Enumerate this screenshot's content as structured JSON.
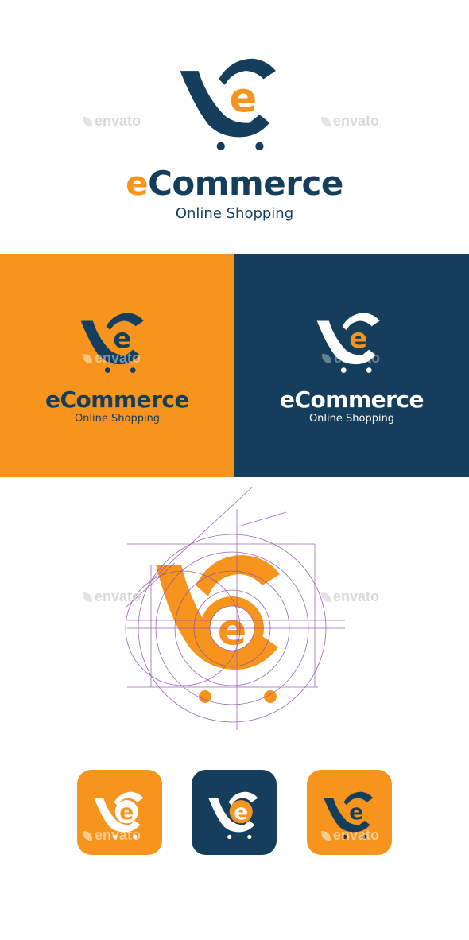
{
  "brand": {
    "prefix": "e",
    "name": "Commerce",
    "tagline": "Online Shopping"
  },
  "watermark": {
    "text": "envato"
  },
  "colors": {
    "orange": "#F7941D",
    "navy": "#143E5C",
    "white": "#FFFFFF",
    "grid_lines": "#8E4BA8"
  },
  "icons": {
    "cart_logo": "cart-logo-icon"
  }
}
